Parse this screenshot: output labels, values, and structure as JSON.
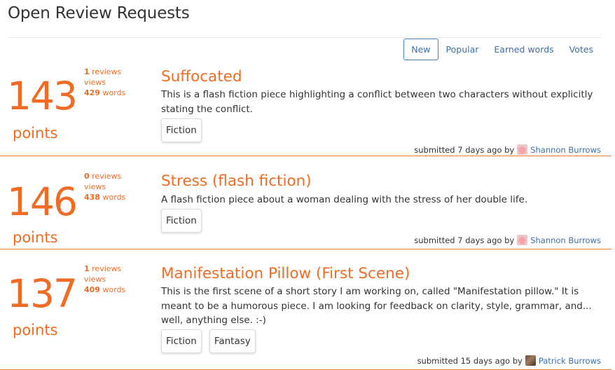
{
  "page": {
    "title": "Open Review Requests"
  },
  "sort_tabs": [
    {
      "label": "New",
      "active": true
    },
    {
      "label": "Popular",
      "active": false
    },
    {
      "label": "Earned words",
      "active": false
    },
    {
      "label": "Votes",
      "active": false
    }
  ],
  "points_label": "points",
  "submitted_prefix": "submitted",
  "by_text": "by",
  "stats_labels": {
    "reviews": "reviews",
    "views": "views",
    "words": "words"
  },
  "requests": [
    {
      "points": "143",
      "reviews": "1",
      "views": "",
      "words": "429",
      "title": "Suffocated",
      "description": "This is a flash fiction piece highlighting a conflict between two characters without explicitly stating the conflict.",
      "tags": [
        "Fiction"
      ],
      "age": "7 days ago",
      "author": "Shannon Burrows",
      "avatar_icon": "pig-avatar-icon"
    },
    {
      "points": "146",
      "reviews": "0",
      "views": "",
      "words": "438",
      "title": "Stress (flash fiction)",
      "description": "A flash fiction piece about a woman dealing with the stress of her double life.",
      "tags": [
        "Fiction"
      ],
      "age": "7 days ago",
      "author": "Shannon Burrows",
      "avatar_icon": "pig-avatar-icon"
    },
    {
      "points": "137",
      "reviews": "1",
      "views": "",
      "words": "409",
      "title": "Manifestation Pillow (First Scene)",
      "description": "This is the first scene of a short story I am working on, called \"Manifestation pillow.\" It is meant to be a humorous piece. I am looking for feedback on clarity, style, grammar, and... well, anything else. :-)",
      "tags": [
        "Fiction",
        "Fantasy"
      ],
      "age": "15 days ago",
      "author": "Patrick Burrows",
      "avatar_icon": "photo-avatar-icon"
    }
  ],
  "colors": {
    "accent": "#f06c25",
    "link": "#3f6fa3",
    "rule": "#e87f3a"
  }
}
